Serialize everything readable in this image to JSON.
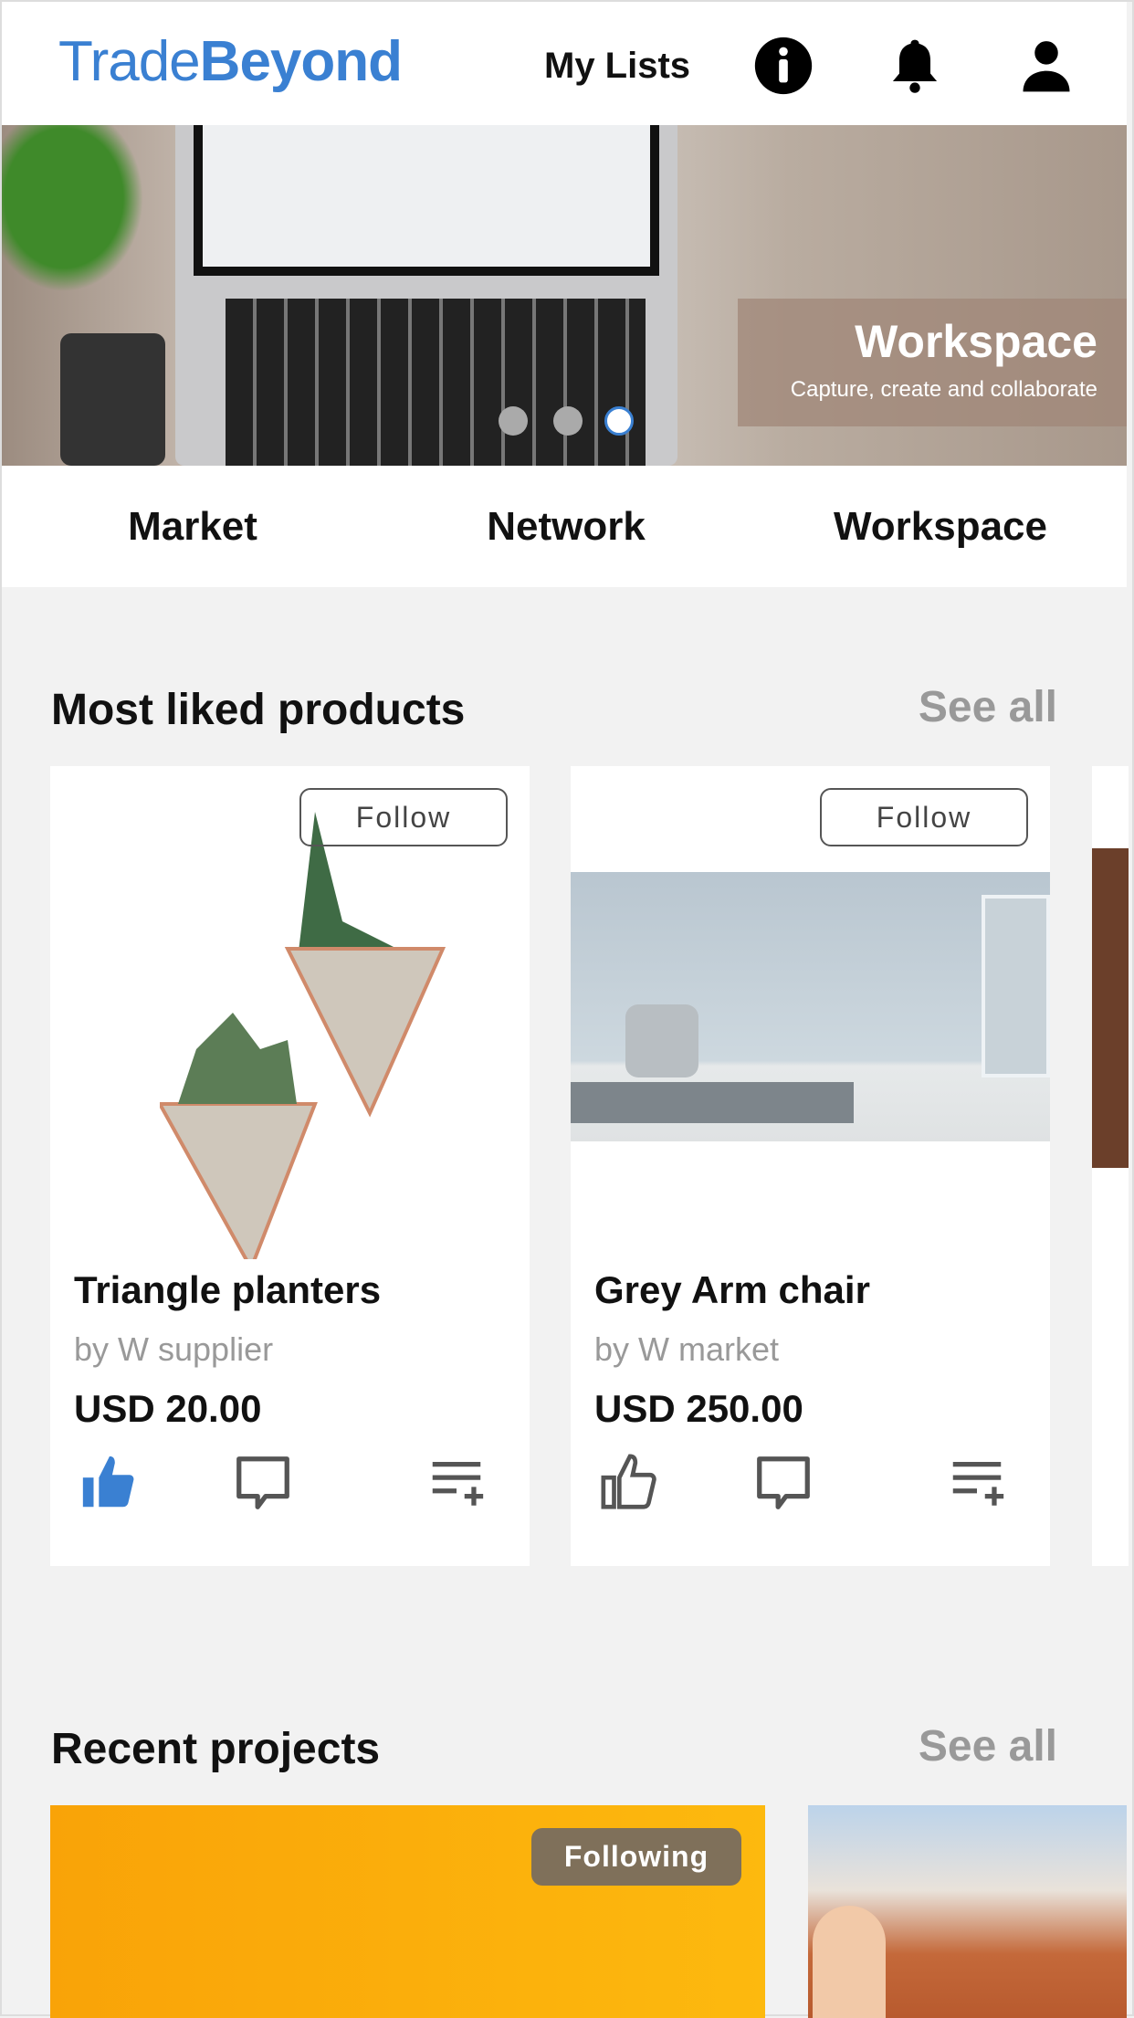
{
  "header": {
    "logo_light": "Trade",
    "logo_bold": "Beyond",
    "my_lists": "My Lists",
    "icons": [
      "info-icon",
      "bell-icon",
      "user-icon"
    ]
  },
  "hero": {
    "title": "Workspace",
    "subtitle": "Capture, create and collaborate",
    "slides": 3,
    "active_slide": 3
  },
  "tabs": [
    {
      "label": "Market"
    },
    {
      "label": "Network"
    },
    {
      "label": "Workspace"
    }
  ],
  "most_liked": {
    "title": "Most liked products",
    "see_all": "See all",
    "products": [
      {
        "name": "Triangle planters",
        "by": "by W supplier",
        "price": "USD 20.00",
        "follow": "Follow",
        "liked": true
      },
      {
        "name": "Grey Arm chair",
        "by": "by W market",
        "price": "USD 250.00",
        "follow": "Follow",
        "liked": false
      }
    ]
  },
  "recent_projects": {
    "title": "Recent projects",
    "see_all": "See all",
    "projects": [
      {
        "badge": "Following"
      }
    ]
  },
  "colors": {
    "brand": "#3a80d2",
    "background": "#f2f2f2",
    "badge": "#7f705a",
    "muted": "#999999"
  }
}
